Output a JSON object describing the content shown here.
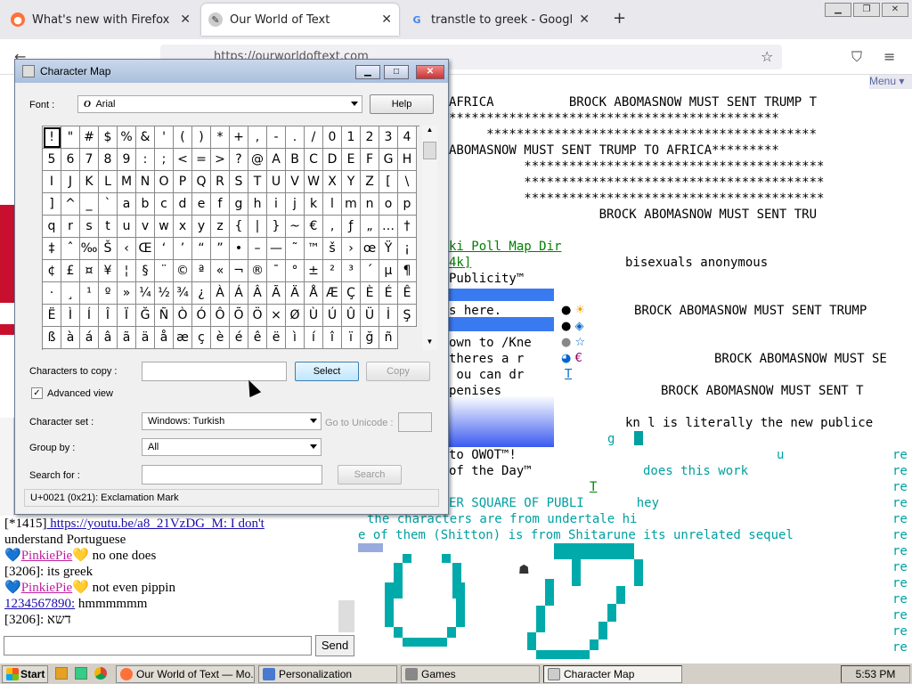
{
  "browser": {
    "tabs": [
      {
        "label": "What's new with Firefox - More",
        "icon": "firefox-icon"
      },
      {
        "label": "Our World of Text",
        "icon": "owot-icon"
      },
      {
        "label": "transtle to greek - Google Search",
        "icon": "google-icon"
      }
    ],
    "new_tab": "+",
    "url": "https://ourworldoftext.com",
    "menu_label": "Menu ▾"
  },
  "page": {
    "art_lines": [
      "AFRICA          BROCK ABOMASNOW MUST SENT TRUMP T",
      "********************************************",
      "     ********************************************",
      "ABOMASNOW MUST SENT TRUMP TO AFRICA*********",
      "          ****************************************",
      "          ****************************************",
      "          ****************************************",
      "                    BROCK ABOMASNOW MUST SENT TRU"
    ],
    "links": "ki Poll Map Dir",
    "link2": "4k]",
    "panel_lines": [
      "Publicity™",
      "s here.",
      "own to /Kne",
      "theres a r",
      " ou can dr",
      "penises",
      "to OWOT™!",
      "of the Day™"
    ],
    "text_lines": [
      "bisexuals anonymous",
      "BROCK ABOMASNOW MUST SENT TRUMP",
      "BROCK ABOMASNOW MUST SE",
      "BROCK ABOMASNOW MUST SENT T",
      "kn l is literally the new publice",
      "does this work"
    ],
    "teal_lines": [
      "ER SQUARE OF PUBLI       hey",
      "the characters are from undertale hi",
      "e of them (Shitton) is from Shitarune its unrelated sequel"
    ],
    "re_col": "re",
    "misc_g": "g",
    "misc_u": "u",
    "misc_t": "T",
    "misc_t2": "T"
  },
  "chat": {
    "lines": [
      {
        "user": "[*1415]",
        "text": " https://youtu.be/a8_21VzDG_M: I don't"
      },
      {
        "user": "",
        "text": "understand Portuguese"
      },
      {
        "user": "PinkiePie",
        "text": " no one does"
      },
      {
        "user": "[3206]:",
        "text": " its greek"
      },
      {
        "user": "PinkiePie",
        "text": " not even pippin"
      },
      {
        "user": "1234567890:",
        "text": " hmmmmmm"
      },
      {
        "user": "[3206]:",
        "text": " דשא"
      }
    ],
    "send_label": "Send"
  },
  "charmap": {
    "title": "Character Map",
    "font_label": "Font :",
    "font_value": "Arial",
    "help": "Help",
    "chars": "!\"#$%&'()*+,-./01234 56789:;<=>?@ABCDEFGH IJKLMNOPQRSTUVWXYZ[\\ ]^_`abcdefghijklmnop qrstuvwxyz{|}~€‚ƒ„…† ‡ˆ‰Š‹Œ‘’“”•–—˜™š›œŸ ¡¢£¤¥¦§¨©ª«¬®¯°±²³´µ ¶·¸¹º»¼½¾¿ÀÁÂÃÄÅÆÇÈÉ ÊËÌÍÎÏĞÑÒÓÔÕÖ×ØÙÚÛÜİ Şßàáâãäåæçèéêëìíîïğñ",
    "copy_label": "Characters to copy :",
    "select": "Select",
    "copy": "Copy",
    "advanced": "Advanced view",
    "charset_label": "Character set :",
    "charset_value": "Windows: Turkish",
    "goto_label": "Go to Unicode :",
    "group_label": "Group by :",
    "group_value": "All",
    "search_label": "Search for :",
    "search_btn": "Search",
    "status": "U+0021 (0x21): Exclamation Mark"
  },
  "taskbar": {
    "start": "Start",
    "items": [
      "Our World of Text — Mo...",
      "Personalization",
      "Games",
      "Character Map"
    ],
    "clock": "5:53 PM"
  }
}
